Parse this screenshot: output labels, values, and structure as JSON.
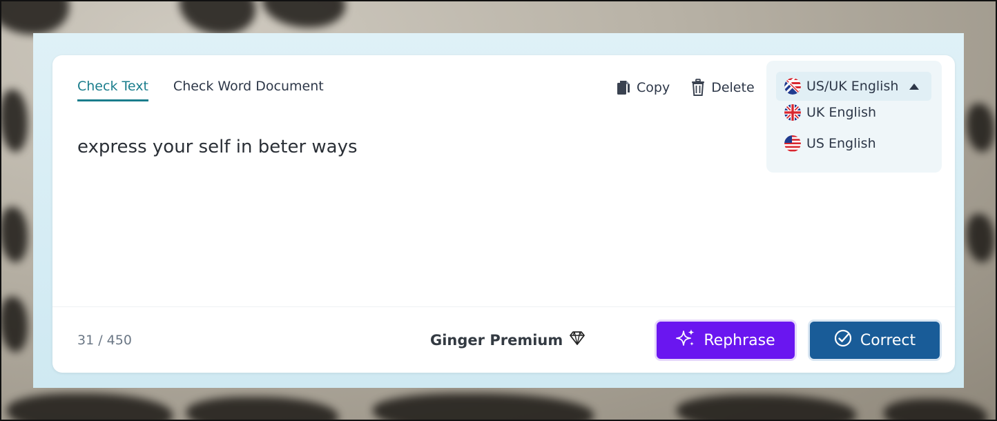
{
  "tabs": [
    {
      "label": "Check Text",
      "active": true
    },
    {
      "label": "Check Word Document",
      "active": false
    }
  ],
  "toolbar": {
    "copy_label": "Copy",
    "delete_label": "Delete"
  },
  "language": {
    "selected": "US/UK English",
    "options": [
      "UK English",
      "US English"
    ]
  },
  "editor": {
    "text": "express your self in beter ways"
  },
  "footer": {
    "counter": "31 / 450",
    "premium_label": "Ginger Premium",
    "rephrase_label": "Rephrase",
    "correct_label": "Correct"
  },
  "colors": {
    "accent_teal": "#1a7d8c",
    "rephrase_purple": "#6a16f0",
    "correct_blue": "#195c98"
  },
  "icons": [
    "copy-icon",
    "trash-icon",
    "uk-us-flag-icon",
    "uk-flag-icon",
    "us-flag-icon",
    "diamond-icon",
    "sparkle-icon",
    "check-circle-icon"
  ]
}
